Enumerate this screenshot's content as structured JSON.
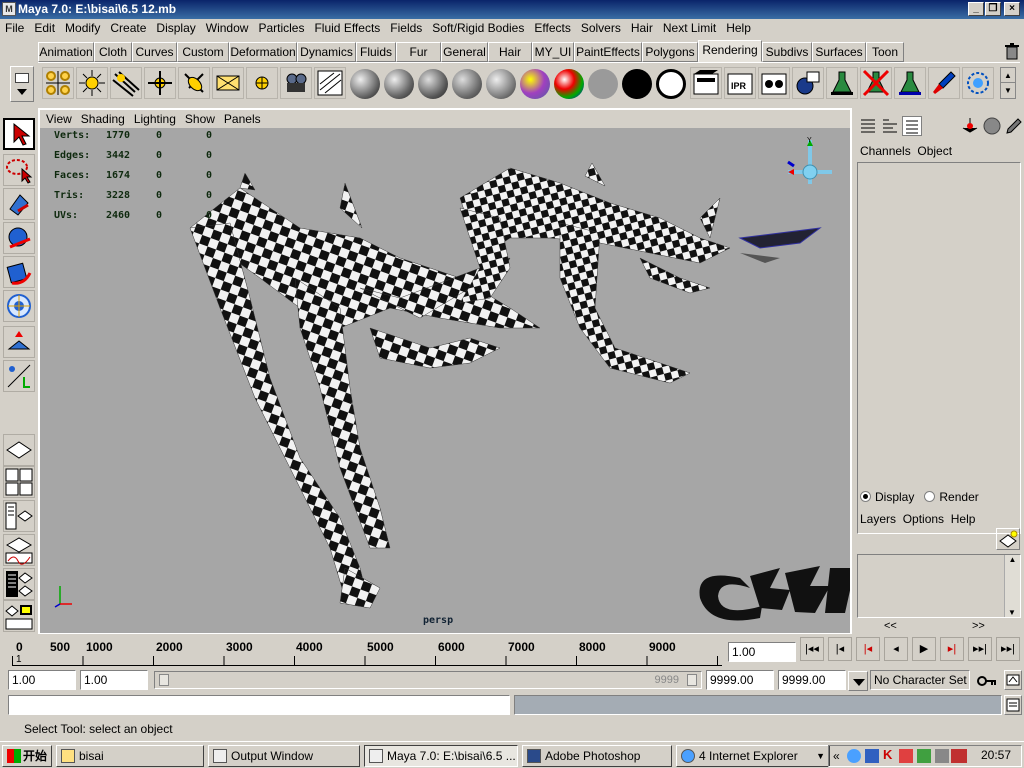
{
  "window": {
    "title": "Maya 7.0: E:\\bisai\\6.5 12.mb",
    "app_icon": "M",
    "minimize": "_",
    "restore": "❐",
    "close": "×"
  },
  "menubar": [
    "File",
    "Edit",
    "Modify",
    "Create",
    "Display",
    "Window",
    "Particles",
    "Fluid Effects",
    "Fields",
    "Soft/Rigid Bodies",
    "Effects",
    "Solvers",
    "Hair",
    "Next Limit",
    "Help"
  ],
  "shelf_tabs": [
    "Animation",
    "Cloth",
    "Curves",
    "Custom",
    "Deformation",
    "Dynamics",
    "Fluids",
    "Fur",
    "General",
    "Hair",
    "MY_UI",
    "PaintEffects",
    "Polygons",
    "Rendering",
    "Subdivs",
    "Surfaces",
    "Toon"
  ],
  "active_shelf_tab": "Rendering",
  "panel_menu": [
    "View",
    "Shading",
    "Lighting",
    "Show",
    "Panels"
  ],
  "hud": {
    "rows": [
      {
        "label": "Verts:",
        "v1": "1770",
        "v2": "0",
        "v3": "0"
      },
      {
        "label": "Edges:",
        "v1": "3442",
        "v2": "0",
        "v3": "0"
      },
      {
        "label": "Faces:",
        "v1": "1674",
        "v2": "0",
        "v3": "0"
      },
      {
        "label": "Tris:",
        "v1": "3228",
        "v2": "0",
        "v3": "0"
      },
      {
        "label": "UVs:",
        "v1": "2460",
        "v2": "0",
        "v3": "0"
      }
    ],
    "camera": "persp"
  },
  "axis_labels": {
    "y": "Y",
    "z": "Z",
    "x": "X"
  },
  "watermark": "CGARTIST",
  "channel_box": {
    "tabs": [
      "Channels",
      "Object"
    ]
  },
  "layer_editor": {
    "display": "Display",
    "render": "Render",
    "menu": [
      "Layers",
      "Options",
      "Help"
    ],
    "left_arrows": "<<",
    "right_arrows": ">>"
  },
  "timeline": {
    "ticks": [
      "0",
      "500",
      "1000",
      "2000",
      "3000",
      "4000",
      "5000",
      "6000",
      "7000",
      "8000",
      "9000"
    ],
    "first_label": "1",
    "current_frame": "1.00"
  },
  "range": {
    "start": "1.00",
    "playback_start": "1.00",
    "slider_end": "9999",
    "playback_end": "9999.00",
    "end": "9999.00",
    "character_set": "No Character Set"
  },
  "playback_buttons": [
    "|◂◂",
    "|◂",
    "|◂",
    "◂",
    "▶",
    "▸|",
    "▸▸|",
    "▸▸|"
  ],
  "helpline": "Select Tool: select an object",
  "taskbar": {
    "start": "开始",
    "tasks": [
      "bisai",
      "Output Window",
      "Maya 7.0: E:\\bisai\\6.5 ...",
      "Adobe Photoshop",
      "4 Internet Explorer"
    ],
    "clock": "20:57",
    "tray_icons": [
      "«",
      "ie-icon",
      "shield-icon",
      "K",
      "pen-icon",
      "network-icon",
      "speaker-icon",
      "rtl-icon"
    ]
  },
  "colors": {
    "title_start": "#0a246a",
    "title_end": "#3a6ea5",
    "viewport_bg": "#a6a6a6",
    "face": "#d4d0c8",
    "hud_text": "#0f2a0f"
  }
}
